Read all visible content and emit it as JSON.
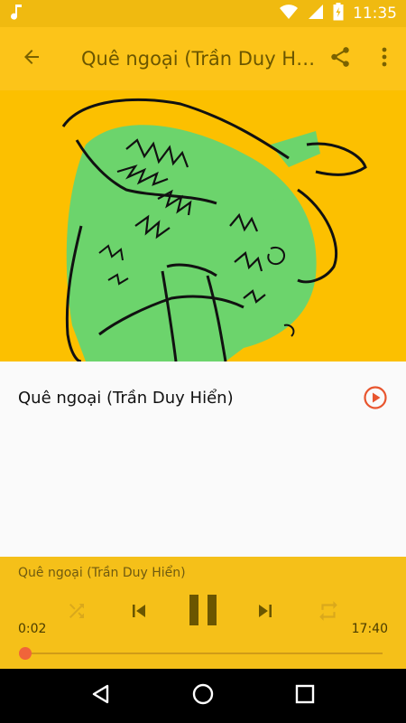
{
  "status_bar": {
    "time": "11:35"
  },
  "app_bar": {
    "title": "Quê ngoại (Trần Duy Hiển)"
  },
  "tracks": [
    {
      "title": "Quê ngoại (Trần Duy Hiển)"
    }
  ],
  "player": {
    "now_playing": "Quê ngoại (Trần Duy Hiển)",
    "elapsed": "0:02",
    "duration": "17:40",
    "progress_fraction": 0.002
  },
  "colors": {
    "status_bar": "#f0ba10",
    "app_bar": "#fcc419",
    "player_bg": "#f5c019",
    "accent": "#f0643a",
    "album_art_bg": "#fcc000",
    "album_art_green": "#6cd46c"
  },
  "icons": {
    "status": [
      "music-note-icon",
      "wifi-icon",
      "signal-icon",
      "battery-icon"
    ],
    "app_bar": [
      "back-arrow-icon",
      "share-icon",
      "more-vert-icon"
    ],
    "track_row": [
      "play-circle-icon"
    ],
    "player": [
      "shuffle-icon",
      "skip-previous-icon",
      "pause-icon",
      "skip-next-icon",
      "repeat-icon"
    ],
    "nav": [
      "back-triangle-icon",
      "home-circle-icon",
      "recents-square-icon"
    ]
  }
}
